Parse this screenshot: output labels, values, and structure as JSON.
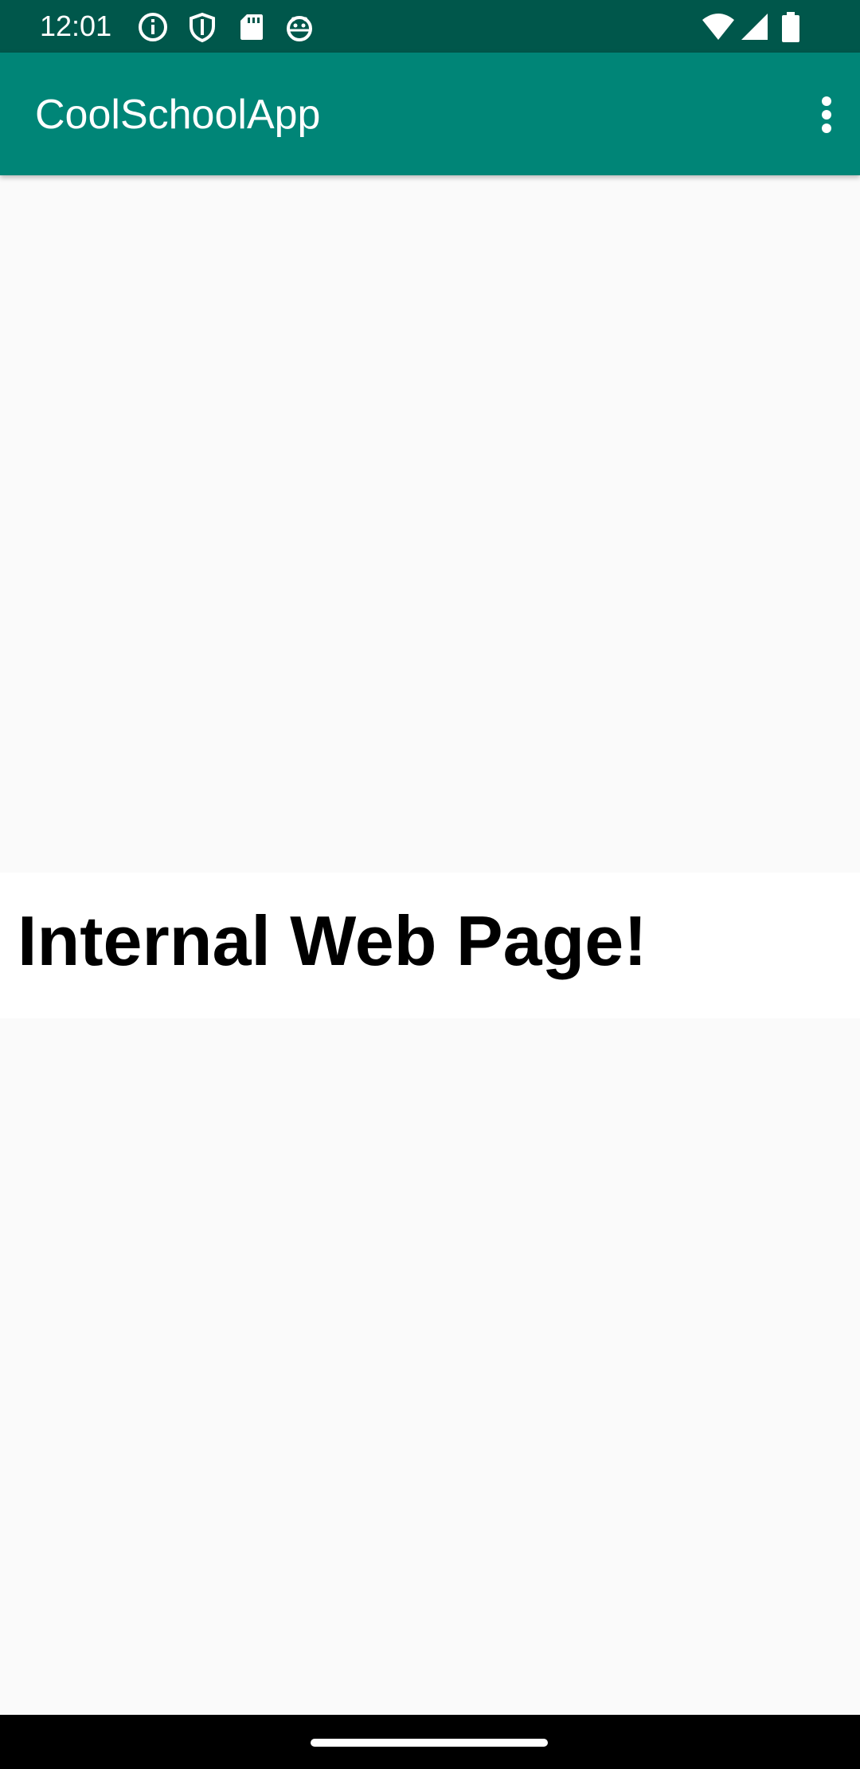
{
  "status_bar": {
    "time": "12:01",
    "icons_left": [
      "info-icon",
      "shield-icon",
      "sd-card-icon",
      "android-debug-icon"
    ],
    "icons_right": [
      "wifi-icon",
      "signal-icon",
      "battery-icon"
    ],
    "background_color": "#00574b"
  },
  "app_bar": {
    "title": "CoolSchoolApp",
    "menu_icon": "more-vert-icon",
    "background_color": "#008577"
  },
  "webview": {
    "heading": "Internal Web Page!"
  }
}
